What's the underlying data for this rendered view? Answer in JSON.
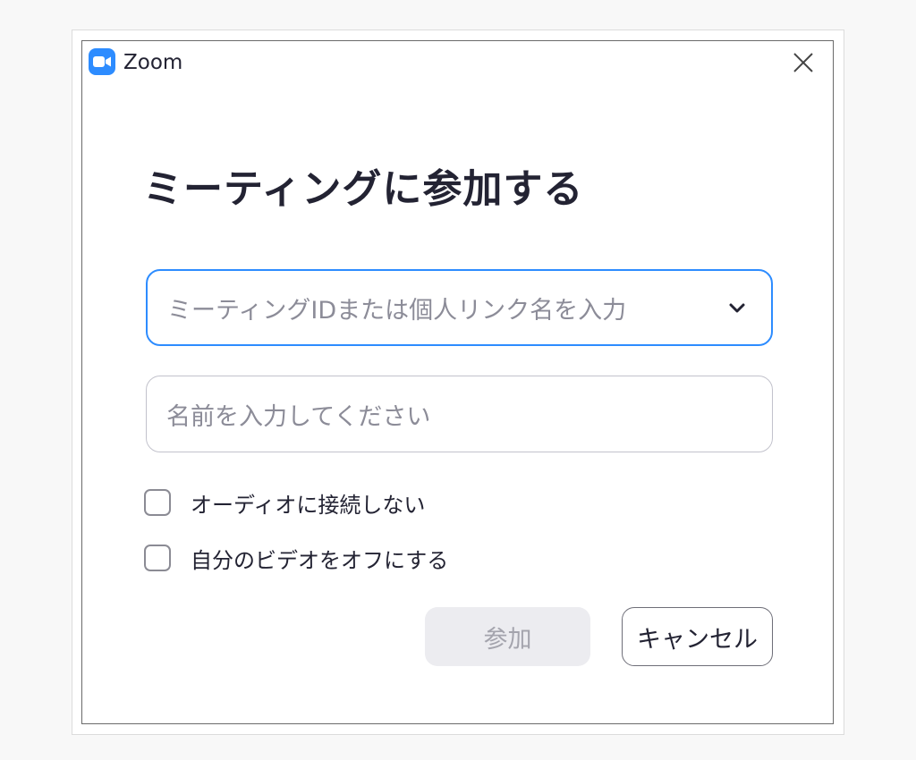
{
  "window": {
    "app_title": "Zoom",
    "app_icon": "zoom-camera-icon",
    "brand_color": "#2d8cff"
  },
  "dialog": {
    "heading": "ミーティングに参加する",
    "meeting_id_placeholder": "ミーティングIDまたは個人リンク名を入力",
    "name_placeholder": "名前を入力してください",
    "options": [
      {
        "label": "オーディオに接続しない",
        "checked": false
      },
      {
        "label": "自分のビデオをオフにする",
        "checked": false
      }
    ],
    "join_label": "参加",
    "cancel_label": "キャンセル"
  }
}
